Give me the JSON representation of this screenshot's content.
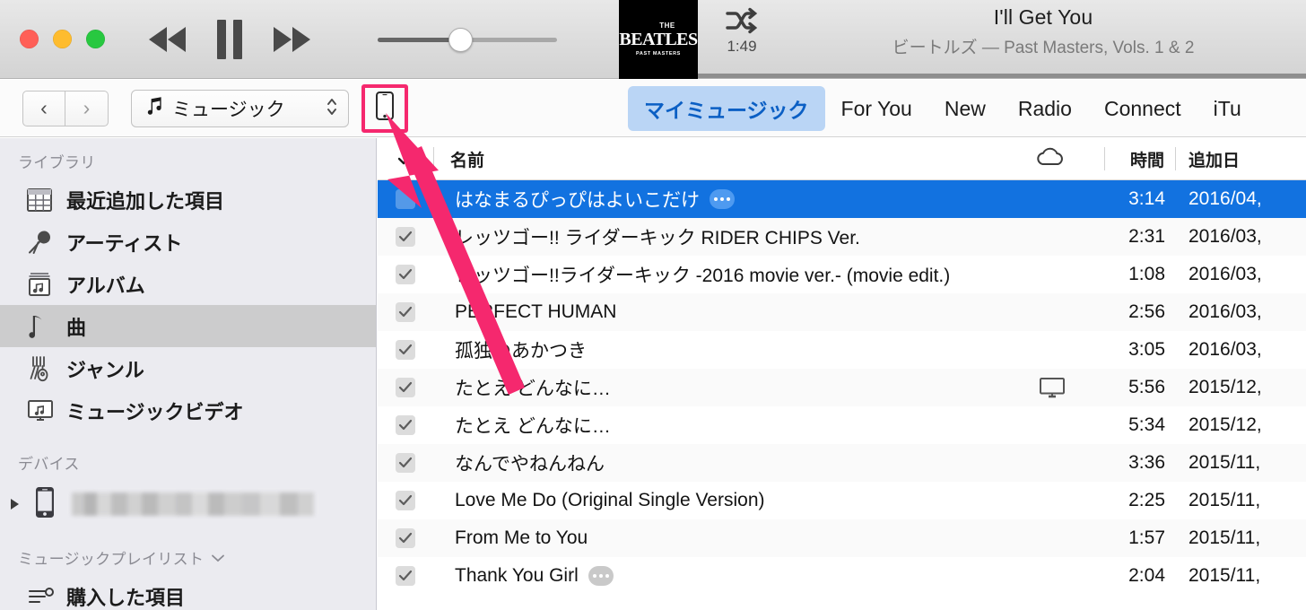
{
  "window": {
    "traffic_lights": [
      "close",
      "minimize",
      "zoom"
    ],
    "colors": {
      "close": "#ff5f57",
      "minimize": "#febc2e",
      "zoom": "#28c840",
      "accent_blue": "#1272e0",
      "annotation_pink": "#f5286e",
      "tab_active_bg": "#bad5f5"
    }
  },
  "player": {
    "rewind_label": "rewind",
    "pause_label": "pause",
    "fastforward_label": "fast-forward",
    "volume_percent": 46,
    "album_art": {
      "line1": "THE",
      "line2": "BEATLES",
      "line3": "PAST MASTERS"
    },
    "shuffle_label": "shuffle",
    "elapsed": "1:49",
    "track_title": "I'll Get You",
    "track_subtitle": "ビートルズ — Past Masters, Vols. 1 & 2"
  },
  "navbar": {
    "back_label": "‹",
    "forward_label": "›",
    "source_label": "ミュージック",
    "device_button_label": "iPhone",
    "tabs": [
      {
        "label": "マイミュージック",
        "active": true
      },
      {
        "label": "For You",
        "active": false
      },
      {
        "label": "New",
        "active": false
      },
      {
        "label": "Radio",
        "active": false
      },
      {
        "label": "Connect",
        "active": false
      },
      {
        "label": "iTu",
        "active": false
      }
    ]
  },
  "sidebar": {
    "library_heading": "ライブラリ",
    "library_items": [
      {
        "label": "最近追加した項目",
        "icon": "grid-icon",
        "selected": false
      },
      {
        "label": "アーティスト",
        "icon": "microphone-icon",
        "selected": false
      },
      {
        "label": "アルバム",
        "icon": "album-icon",
        "selected": false
      },
      {
        "label": "曲",
        "icon": "music-note-icon",
        "selected": true
      },
      {
        "label": "ジャンル",
        "icon": "guitars-icon",
        "selected": false
      },
      {
        "label": "ミュージックビデオ",
        "icon": "music-video-icon",
        "selected": false
      }
    ],
    "devices_heading": "デバイス",
    "device_name_redacted": true,
    "playlists_heading": "ミュージックプレイリスト",
    "playlist_items": [
      {
        "label": "購入した項目",
        "icon": "playlist-icon"
      }
    ]
  },
  "table": {
    "headers": {
      "check": "✓",
      "name": "名前",
      "cloud": "cloud-icon",
      "time": "時間",
      "date": "追加日"
    },
    "rows": [
      {
        "checked": false,
        "name": "はなまるぴっぴはよいこだけ",
        "menu": true,
        "media_icon": "",
        "time": "3:14",
        "date": "2016/04,",
        "selected": true
      },
      {
        "checked": true,
        "name": "レッツゴー!! ライダーキック RIDER CHIPS Ver.",
        "menu": false,
        "media_icon": "",
        "time": "2:31",
        "date": "2016/03,",
        "selected": false
      },
      {
        "checked": true,
        "name": "レッツゴー!!ライダーキック -2016 movie ver.- (movie edit.)",
        "menu": false,
        "media_icon": "",
        "time": "1:08",
        "date": "2016/03,",
        "selected": false
      },
      {
        "checked": true,
        "name": "PERFECT HUMAN",
        "menu": false,
        "media_icon": "",
        "time": "2:56",
        "date": "2016/03,",
        "selected": false
      },
      {
        "checked": true,
        "name": "孤独のあかつき",
        "menu": false,
        "media_icon": "",
        "time": "3:05",
        "date": "2016/03,",
        "selected": false
      },
      {
        "checked": true,
        "name": "たとえ どんなに…",
        "menu": false,
        "media_icon": "display-icon",
        "time": "5:56",
        "date": "2015/12,",
        "selected": false
      },
      {
        "checked": true,
        "name": "たとえ どんなに…",
        "menu": false,
        "media_icon": "",
        "time": "5:34",
        "date": "2015/12,",
        "selected": false
      },
      {
        "checked": true,
        "name": "なんでやねんねん",
        "menu": false,
        "media_icon": "",
        "time": "3:36",
        "date": "2015/11,",
        "selected": false
      },
      {
        "checked": true,
        "name": "Love Me Do (Original Single Version)",
        "menu": false,
        "media_icon": "",
        "time": "2:25",
        "date": "2015/11,",
        "selected": false
      },
      {
        "checked": true,
        "name": "From Me to You",
        "menu": false,
        "media_icon": "",
        "time": "1:57",
        "date": "2015/11,",
        "selected": false
      },
      {
        "checked": true,
        "name": "Thank You Girl",
        "menu": true,
        "media_icon": "",
        "time": "2:04",
        "date": "2015/11,",
        "selected": false
      }
    ]
  },
  "annotation": {
    "type": "arrow",
    "points_to": "device-button",
    "color": "#f5286e"
  }
}
